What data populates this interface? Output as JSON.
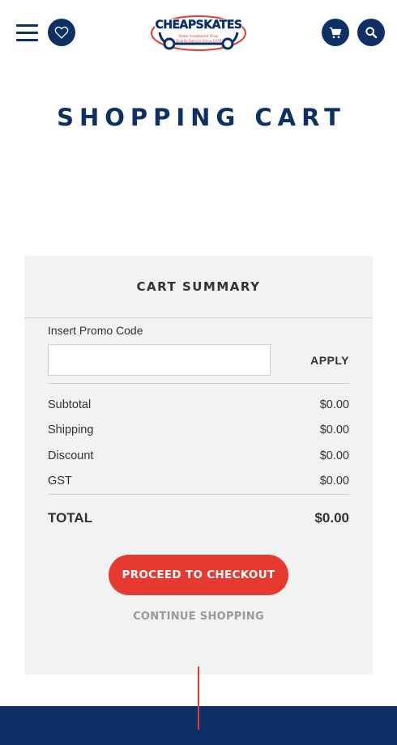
{
  "header": {
    "logo_text": "CHEAPSKATES",
    "logo_tagline_1": "Skate Snowboard Shop",
    "logo_tagline_2": "Quality Service Since 1978",
    "icons": [
      "menu-icon",
      "heart-icon",
      "cart-icon",
      "search-icon"
    ]
  },
  "page": {
    "title": "SHOPPING CART"
  },
  "summary": {
    "title": "CART SUMMARY",
    "promo_label": "Insert Promo Code",
    "promo_value": "",
    "apply_label": "APPLY",
    "rows": [
      {
        "label": "Subtotal",
        "value": "$0.00"
      },
      {
        "label": "Shipping",
        "value": "$0.00"
      },
      {
        "label": "Discount",
        "value": "$0.00"
      },
      {
        "label": "GST",
        "value": "$0.00"
      }
    ],
    "total_label": "TOTAL",
    "total_value": "$0.00",
    "checkout_label": "PROCEED TO CHECKOUT",
    "continue_label": "CONTINUE SHOPPING"
  },
  "colors": {
    "brand_navy": "#0d3166",
    "accent_red": "#e63a30",
    "panel_bg": "#f2f2f2",
    "muted_text": "#9a9a9a"
  }
}
